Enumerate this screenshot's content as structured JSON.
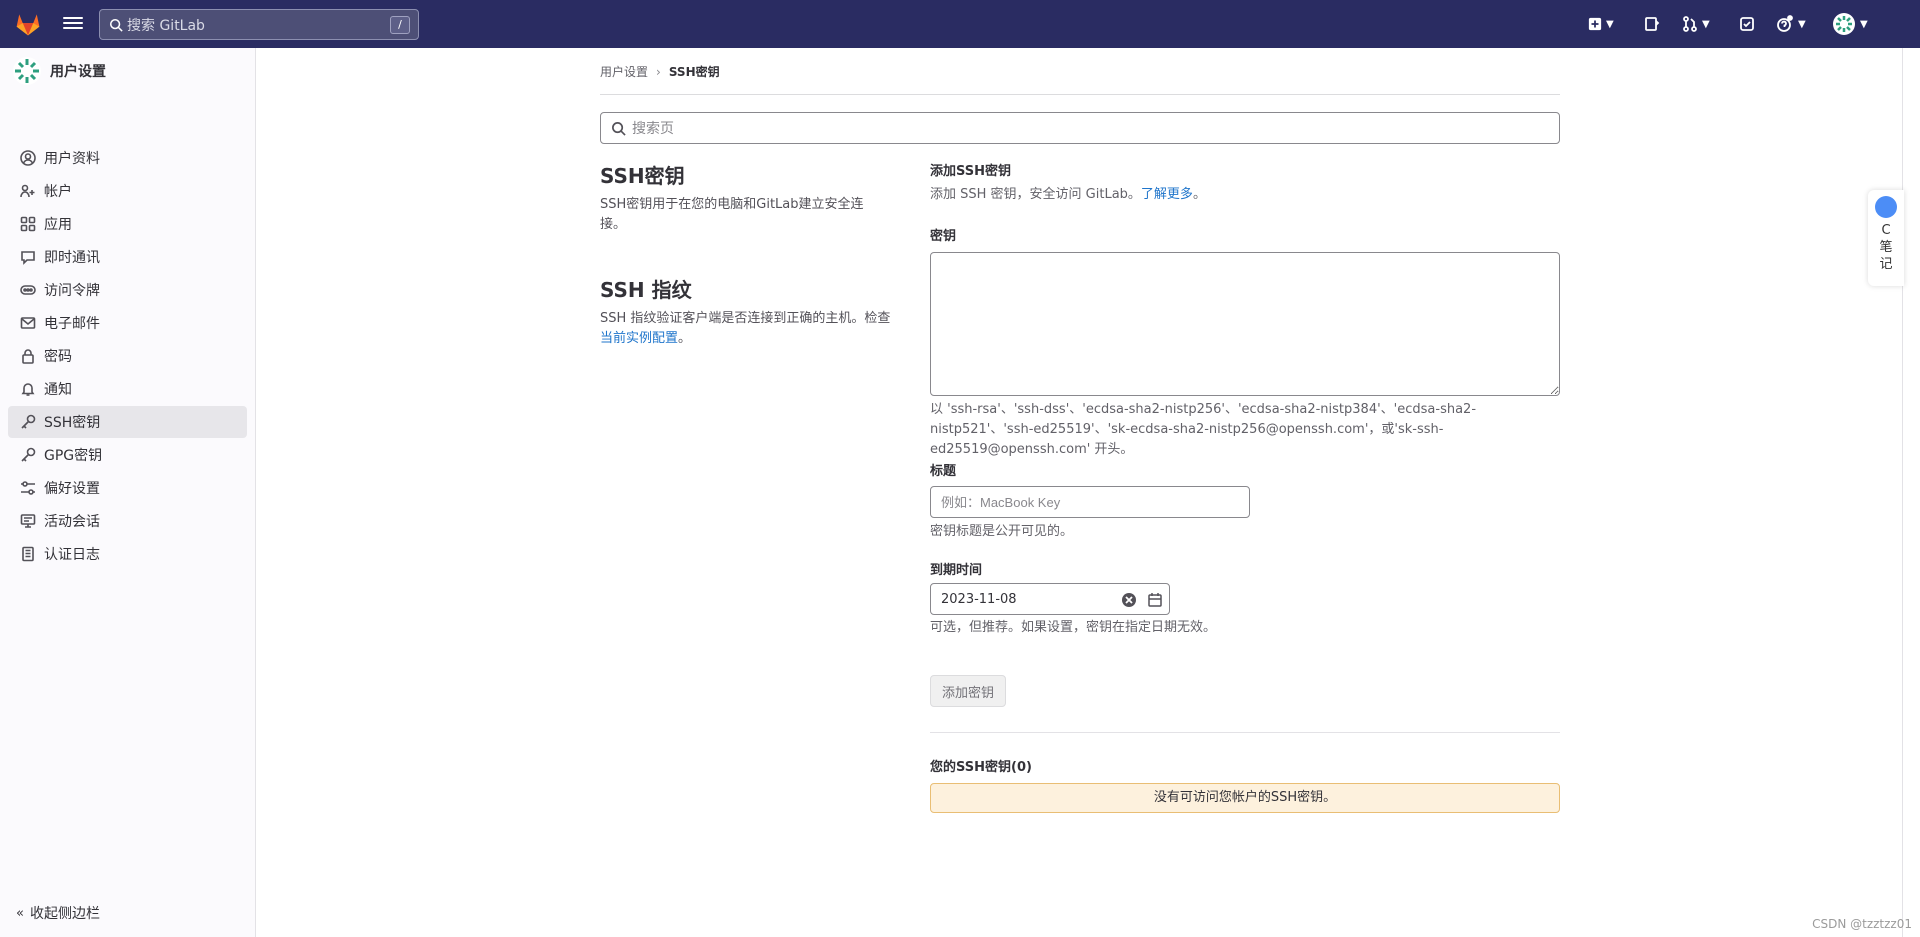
{
  "topbar": {
    "search_placeholder": "搜索 GitLab",
    "search_shortcut": "/"
  },
  "sidebar": {
    "title": "用户设置",
    "items": [
      {
        "label": "用户资料",
        "icon": "user-icon"
      },
      {
        "label": "帐户",
        "icon": "account-icon"
      },
      {
        "label": "应用",
        "icon": "applications-icon"
      },
      {
        "label": "即时通讯",
        "icon": "comment-icon"
      },
      {
        "label": "访问令牌",
        "icon": "token-icon"
      },
      {
        "label": "电子邮件",
        "icon": "mail-icon"
      },
      {
        "label": "密码",
        "icon": "lock-icon"
      },
      {
        "label": "通知",
        "icon": "bell-icon"
      },
      {
        "label": "SSH密钥",
        "icon": "key-icon"
      },
      {
        "label": "GPG密钥",
        "icon": "key-icon"
      },
      {
        "label": "偏好设置",
        "icon": "preferences-icon"
      },
      {
        "label": "活动会话",
        "icon": "monitor-icon"
      },
      {
        "label": "认证日志",
        "icon": "log-icon"
      }
    ],
    "active_index": 8,
    "collapse_label": "收起侧边栏"
  },
  "breadcrumb": {
    "parent": "用户设置",
    "current": "SSH密钥"
  },
  "page_search": {
    "placeholder": "搜索页"
  },
  "left": {
    "ssh_title": "SSH密钥",
    "ssh_desc": "SSH密钥用于在您的电脑和GitLab建立安全连接。",
    "fp_title": "SSH 指纹",
    "fp_desc_pre": "SSH 指纹验证客户端是否连接到正确的主机。检查",
    "fp_desc_link": "当前实例配置",
    "fp_desc_post": "。"
  },
  "form": {
    "add_title": "添加SSH密钥",
    "add_desc_pre": "添加 SSH 密钥，安全访问 GitLab。",
    "add_desc_link": "了解更多",
    "add_desc_post": "。",
    "key_label": "密钥",
    "key_help": "以 'ssh-rsa'、'ssh-dss'、'ecdsa-sha2-nistp256'、'ecdsa-sha2-nistp384'、'ecdsa-sha2-nistp521'、'ssh-ed25519'、'sk-ecdsa-sha2-nistp256@openssh.com'，或'sk-ssh-ed25519@openssh.com' 开头。",
    "title_label": "标题",
    "title_placeholder": "例如：MacBook Key",
    "title_help": "密钥标题是公开可见的。",
    "expiry_label": "到期时间",
    "expiry_value": "2023-11-08",
    "expiry_help": "可选，但推荐。如果设置，密钥在指定日期无效。",
    "submit_label": "添加密钥"
  },
  "keys": {
    "heading": "您的SSH密钥(0)",
    "empty": "没有可访问您帐户的SSH密钥。"
  },
  "notes_widget": {
    "label": "C\n笔\n记"
  },
  "watermark": "CSDN @tzztzz01"
}
